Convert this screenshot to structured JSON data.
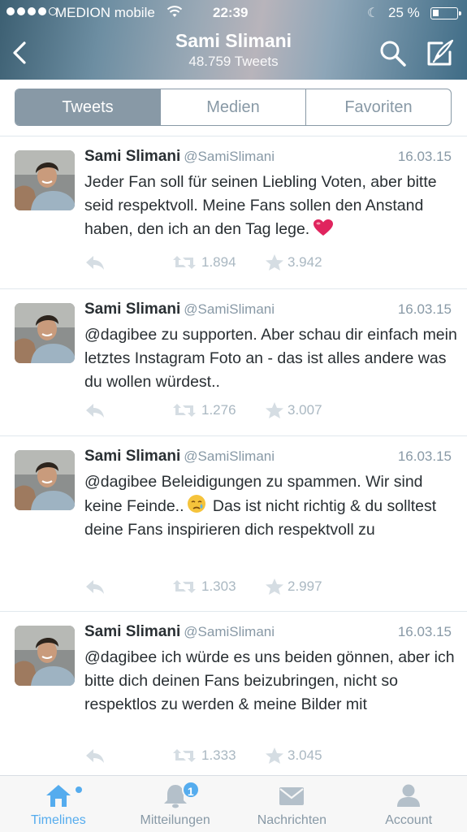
{
  "status_bar": {
    "carrier": "MEDION mobile",
    "time": "22:39",
    "battery_percent_text": "25 %",
    "battery_level": 0.25
  },
  "header": {
    "name": "Sami Slimani",
    "tweet_count": "48.759 Tweets"
  },
  "segments": [
    {
      "label": "Tweets",
      "active": true
    },
    {
      "label": "Medien",
      "active": false
    },
    {
      "label": "Favoriten",
      "active": false
    }
  ],
  "tweets": [
    {
      "name": "Sami Slimani",
      "handle": "@SamiSlimani",
      "date": "16.03.15",
      "text": "Jeder Fan soll für seinen Liebling Voten, aber bitte seid respektvoll. Meine Fans sollen den Anstand haben, den ich an den Tag lege.",
      "emoji": "heart-emoji",
      "retweets": "1.894",
      "favorites": "3.942"
    },
    {
      "name": "Sami Slimani",
      "handle": "@SamiSlimani",
      "date": "16.03.15",
      "text": "@dagibee zu supporten. Aber schau dir einfach mein letztes Instagram Foto an - das ist alles andere was du wollen würdest..",
      "emoji": "",
      "retweets": "1.276",
      "favorites": "3.007"
    },
    {
      "name": "Sami Slimani",
      "handle": "@SamiSlimani",
      "date": "16.03.15",
      "text_before": "@dagibee Beleidigungen zu spammen. Wir sind keine Feinde..",
      "text_after": " Das ist nicht richtig & du solltest deine Fans inspirieren dich respektvoll zu",
      "emoji": "sad-face-emoji",
      "retweets": "1.303",
      "favorites": "2.997"
    },
    {
      "name": "Sami Slimani",
      "handle": "@SamiSlimani",
      "date": "16.03.15",
      "text": "@dagibee ich würde es uns beiden gönnen, aber ich bitte dich deinen Fans beizubringen, nicht so respektlos zu werden & meine Bilder mit",
      "emoji": "",
      "retweets": "1.333",
      "favorites": "3.045"
    }
  ],
  "tabbar": {
    "items": [
      {
        "label": "Timelines",
        "icon": "home-icon",
        "active": true
      },
      {
        "label": "Mitteilungen",
        "icon": "bell-icon",
        "active": false,
        "badge": "1"
      },
      {
        "label": "Nachrichten",
        "icon": "envelope-icon",
        "active": false
      },
      {
        "label": "Account",
        "icon": "person-icon",
        "active": false
      }
    ]
  },
  "colors": {
    "accent": "#55acee",
    "muted": "#8899a6",
    "text": "#292f33",
    "heart": "#e0245e"
  }
}
